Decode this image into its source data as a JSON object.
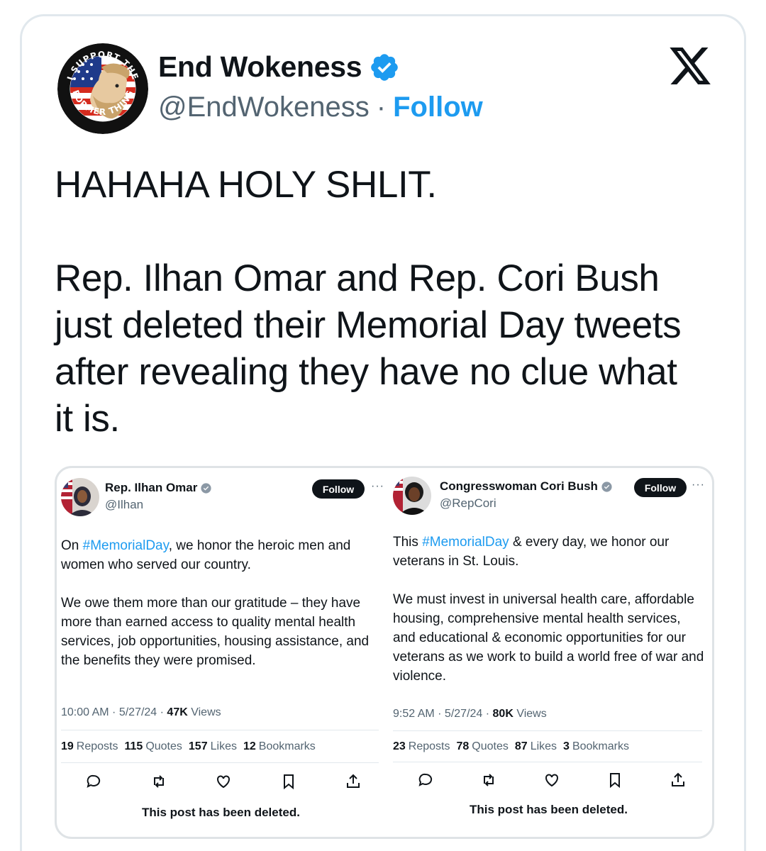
{
  "author": {
    "display_name": "End Wokeness",
    "handle": "@EndWokeness",
    "separator": "·",
    "follow_label": "Follow",
    "avatar_ring_top_text": "I SUPPORT THE",
    "avatar_ring_bottom_text": "FORMER THING"
  },
  "tweet": {
    "paragraph_1": "HAHAHA HOLY SHLIT.",
    "paragraph_2": "Rep. Ilhan Omar and Rep. Cori Bush\njust deleted their Memorial Day tweets\nafter revealing they have no clue what\nit is."
  },
  "colors": {
    "accent": "#1d9bf0",
    "text": "#0f1419",
    "muted": "#536471",
    "border": "#e1e8ed"
  },
  "embedded": [
    {
      "name": "Rep. Ilhan Omar",
      "handle": "@Ilhan",
      "follow_label": "Follow",
      "more": "···",
      "para1_prefix": "On ",
      "para1_hashtag": "#MemorialDay",
      "para1_suffix": ", we honor the heroic men and women who served our country.",
      "para2": "We owe them more than our gratitude – they have more than earned access to quality mental health services, job opportunities, housing assistance, and the benefits they were promised.",
      "timestamp": "10:00 AM · 5/27/24 · ",
      "views_count": "47K",
      "views_label": " Views",
      "stats": [
        {
          "count": "19",
          "label": "Reposts"
        },
        {
          "count": "115",
          "label": "Quotes"
        },
        {
          "count": "157",
          "label": "Likes"
        },
        {
          "count": "12",
          "label": "Bookmarks"
        }
      ],
      "deleted_text": "This post has been deleted."
    },
    {
      "name": "Congresswoman Cori Bush",
      "handle": "@RepCori",
      "follow_label": "Follow",
      "more": "···",
      "para1_prefix": "This ",
      "para1_hashtag": "#MemorialDay",
      "para1_suffix": " & every day, we honor our veterans in St. Louis.",
      "para2": "We must invest in universal health care, affordable housing, comprehensive mental health services, and educational & economic opportunities for our veterans as we work to build a world free of war and violence.",
      "timestamp": "9:52 AM · 5/27/24 · ",
      "views_count": "80K",
      "views_label": " Views",
      "stats": [
        {
          "count": "23",
          "label": "Reposts"
        },
        {
          "count": "78",
          "label": "Quotes"
        },
        {
          "count": "87",
          "label": "Likes"
        },
        {
          "count": "3",
          "label": "Bookmarks"
        }
      ],
      "deleted_text": "This post has been deleted."
    }
  ],
  "icons": [
    "verified-badge-icon",
    "x-logo-icon",
    "reply-icon",
    "repost-icon",
    "like-icon",
    "bookmark-icon",
    "share-icon",
    "more-icon"
  ]
}
